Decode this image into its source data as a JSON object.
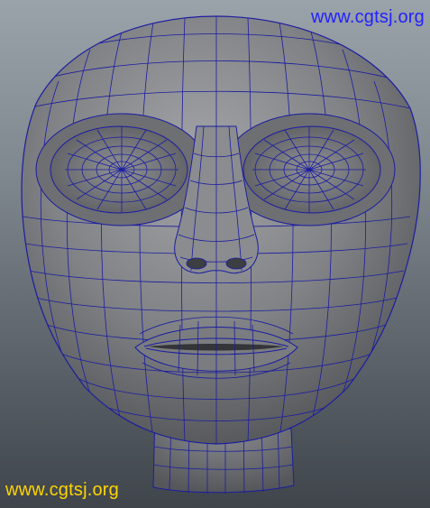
{
  "viewport": {
    "background_top": "#9aa2aa",
    "background_bottom": "#3f454b"
  },
  "model": {
    "subject": "head-mesh",
    "skin_color": "#7b7d80",
    "wire_color": "#1c1ca0"
  },
  "watermarks": {
    "top": {
      "text": "www.cgtsj.org",
      "color": "#2222ff"
    },
    "bottom": {
      "text": "www.cgtsj.org",
      "color": "#ffd400"
    }
  }
}
